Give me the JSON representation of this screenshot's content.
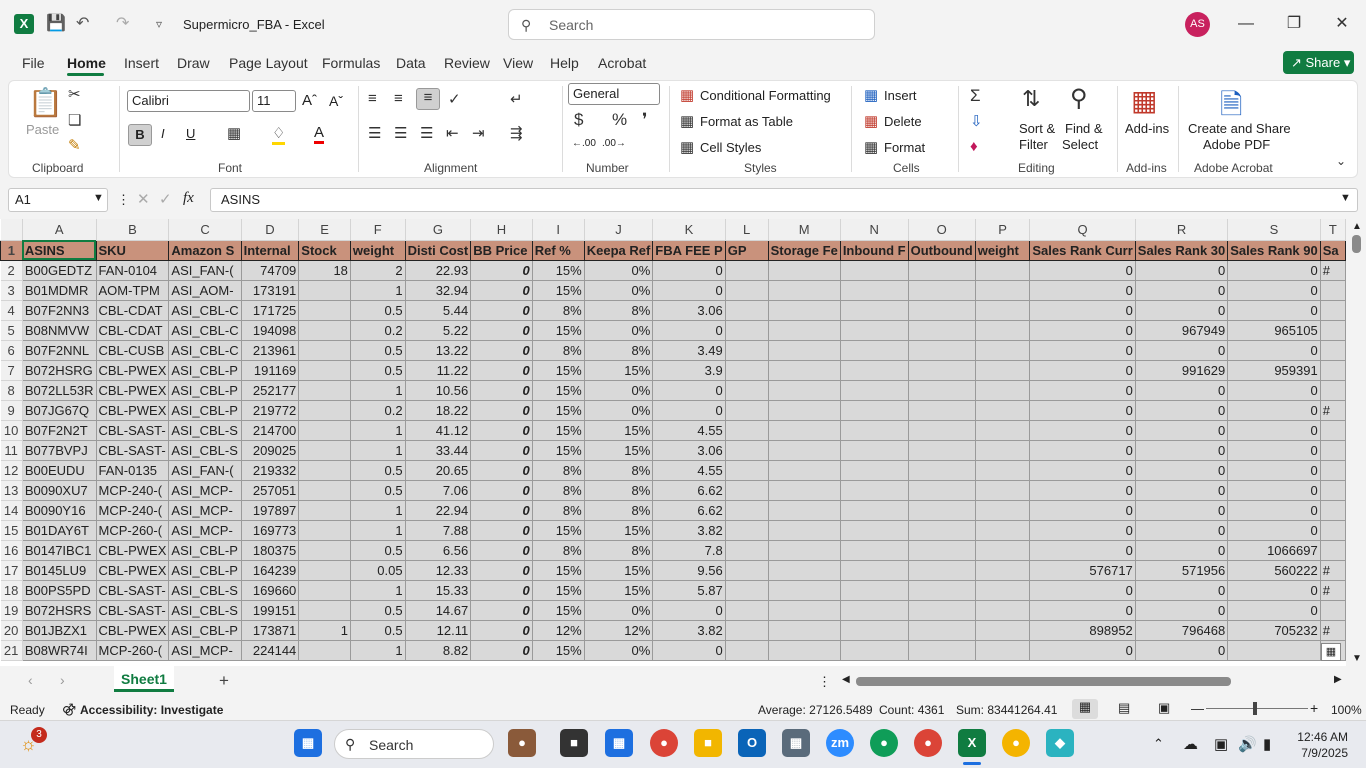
{
  "window": {
    "title": "Supermicro_FBA  -  Excel",
    "search_placeholder": "Search",
    "user_initials": "AS"
  },
  "menu": [
    "File",
    "Home",
    "Insert",
    "Draw",
    "Page Layout",
    "Formulas",
    "Data",
    "Review",
    "View",
    "Help",
    "Acrobat"
  ],
  "share_label": "Share",
  "ribbon": {
    "clipboard": {
      "label": "Clipboard",
      "paste": "Paste"
    },
    "font": {
      "label": "Font",
      "family": "Calibri",
      "size": "11"
    },
    "alignment": {
      "label": "Alignment"
    },
    "number": {
      "label": "Number",
      "format": "General"
    },
    "styles": {
      "label": "Styles",
      "conditional": "Conditional Formatting",
      "format_table": "Format as Table",
      "cell_styles": "Cell Styles"
    },
    "cells": {
      "label": "Cells",
      "insert": "Insert",
      "delete": "Delete",
      "format": "Format"
    },
    "editing": {
      "label": "Editing",
      "sort_filter_1": "Sort &",
      "sort_filter_2": "Filter",
      "find_select_1": "Find &",
      "find_select_2": "Select"
    },
    "addins": {
      "label": "Add-ins",
      "button": "Add-ins"
    },
    "acrobat": {
      "label": "Adobe Acrobat",
      "button_1": "Create and Share",
      "button_2": "Adobe PDF"
    }
  },
  "formula_bar": {
    "name_box": "A1",
    "fx": "fx",
    "content": "ASINS"
  },
  "columns": [
    "A",
    "B",
    "C",
    "D",
    "E",
    "F",
    "G",
    "H",
    "I",
    "J",
    "K",
    "L",
    "M",
    "N",
    "O",
    "P",
    "Q",
    "R",
    "S",
    "T"
  ],
  "headers": [
    "ASINS",
    "SKU",
    "Amazon S",
    "Internal",
    "Stock",
    "weight",
    "Disti Cost",
    "BB Price",
    "Ref %",
    "Keepa Ref",
    "FBA FEE P",
    "GP",
    "Storage Fe",
    "Inbound F",
    "Outbound",
    "weight",
    "Sales Rank Curr",
    "Sales Rank 30",
    "Sales Rank 90",
    "Sa"
  ],
  "rows": [
    [
      "2",
      "B00GEDTZ",
      "FAN-0104",
      "ASI_FAN-(",
      "74709",
      "18",
      "2",
      "22.93",
      "0",
      "15%",
      "0%",
      "0",
      "",
      "",
      "",
      "",
      "",
      "0",
      "0",
      "0",
      "#"
    ],
    [
      "3",
      "B01MDMR",
      "AOM-TPM",
      "ASI_AOM-",
      "173191",
      "",
      "1",
      "32.94",
      "0",
      "15%",
      "0%",
      "0",
      "",
      "",
      "",
      "",
      "",
      "0",
      "0",
      "0",
      ""
    ],
    [
      "4",
      "B07F2NN3",
      "CBL-CDAT",
      "ASI_CBL-C",
      "171725",
      "",
      "0.5",
      "5.44",
      "0",
      "8%",
      "8%",
      "3.06",
      "",
      "",
      "",
      "",
      "",
      "0",
      "0",
      "0",
      ""
    ],
    [
      "5",
      "B08NMVW",
      "CBL-CDAT",
      "ASI_CBL-C",
      "194098",
      "",
      "0.2",
      "5.22",
      "0",
      "15%",
      "0%",
      "0",
      "",
      "",
      "",
      "",
      "",
      "0",
      "967949",
      "965105",
      ""
    ],
    [
      "6",
      "B07F2NNL",
      "CBL-CUSB",
      "ASI_CBL-C",
      "213961",
      "",
      "0.5",
      "13.22",
      "0",
      "8%",
      "8%",
      "3.49",
      "",
      "",
      "",
      "",
      "",
      "0",
      "0",
      "0",
      ""
    ],
    [
      "7",
      "B072HSRG",
      "CBL-PWEX",
      "ASI_CBL-P",
      "191169",
      "",
      "0.5",
      "11.22",
      "0",
      "15%",
      "15%",
      "3.9",
      "",
      "",
      "",
      "",
      "",
      "0",
      "991629",
      "959391",
      ""
    ],
    [
      "8",
      "B072LL53R",
      "CBL-PWEX",
      "ASI_CBL-P",
      "252177",
      "",
      "1",
      "10.56",
      "0",
      "15%",
      "0%",
      "0",
      "",
      "",
      "",
      "",
      "",
      "0",
      "0",
      "0",
      ""
    ],
    [
      "9",
      "B07JG67Q",
      "CBL-PWEX",
      "ASI_CBL-P",
      "219772",
      "",
      "0.2",
      "18.22",
      "0",
      "15%",
      "0%",
      "0",
      "",
      "",
      "",
      "",
      "",
      "0",
      "0",
      "0",
      "#"
    ],
    [
      "10",
      "B07F2N2T",
      "CBL-SAST-",
      "ASI_CBL-S",
      "214700",
      "",
      "1",
      "41.12",
      "0",
      "15%",
      "15%",
      "4.55",
      "",
      "",
      "",
      "",
      "",
      "0",
      "0",
      "0",
      ""
    ],
    [
      "11",
      "B077BVPJ",
      "CBL-SAST-",
      "ASI_CBL-S",
      "209025",
      "",
      "1",
      "33.44",
      "0",
      "15%",
      "15%",
      "3.06",
      "",
      "",
      "",
      "",
      "",
      "0",
      "0",
      "0",
      ""
    ],
    [
      "12",
      "B00EUDU",
      "FAN-0135",
      "ASI_FAN-(",
      "219332",
      "",
      "0.5",
      "20.65",
      "0",
      "8%",
      "8%",
      "4.55",
      "",
      "",
      "",
      "",
      "",
      "0",
      "0",
      "0",
      ""
    ],
    [
      "13",
      "B0090XU7",
      "MCP-240-(",
      "ASI_MCP-",
      "257051",
      "",
      "0.5",
      "7.06",
      "0",
      "8%",
      "8%",
      "6.62",
      "",
      "",
      "",
      "",
      "",
      "0",
      "0",
      "0",
      ""
    ],
    [
      "14",
      "B0090Y16",
      "MCP-240-(",
      "ASI_MCP-",
      "197897",
      "",
      "1",
      "22.94",
      "0",
      "8%",
      "8%",
      "6.62",
      "",
      "",
      "",
      "",
      "",
      "0",
      "0",
      "0",
      ""
    ],
    [
      "15",
      "B01DAY6T",
      "MCP-260-(",
      "ASI_MCP-",
      "169773",
      "",
      "1",
      "7.88",
      "0",
      "15%",
      "15%",
      "3.82",
      "",
      "",
      "",
      "",
      "",
      "0",
      "0",
      "0",
      ""
    ],
    [
      "16",
      "B0147IBC1",
      "CBL-PWEX",
      "ASI_CBL-P",
      "180375",
      "",
      "0.5",
      "6.56",
      "0",
      "8%",
      "8%",
      "7.8",
      "",
      "",
      "",
      "",
      "",
      "0",
      "0",
      "1066697",
      ""
    ],
    [
      "17",
      "B0145LU9",
      "CBL-PWEX",
      "ASI_CBL-P",
      "164239",
      "",
      "0.05",
      "12.33",
      "0",
      "15%",
      "15%",
      "9.56",
      "",
      "",
      "",
      "",
      "",
      "576717",
      "571956",
      "560222",
      "#"
    ],
    [
      "18",
      "B00PS5PD",
      "CBL-SAST-",
      "ASI_CBL-S",
      "169660",
      "",
      "1",
      "15.33",
      "0",
      "15%",
      "15%",
      "5.87",
      "",
      "",
      "",
      "",
      "",
      "0",
      "0",
      "0",
      "#"
    ],
    [
      "19",
      "B072HSRS",
      "CBL-SAST-",
      "ASI_CBL-S",
      "199151",
      "",
      "0.5",
      "14.67",
      "0",
      "15%",
      "0%",
      "0",
      "",
      "",
      "",
      "",
      "",
      "0",
      "0",
      "0",
      ""
    ],
    [
      "20",
      "B01JBZX1",
      "CBL-PWEX",
      "ASI_CBL-P",
      "173871",
      "1",
      "0.5",
      "12.11",
      "0",
      "12%",
      "12%",
      "3.82",
      "",
      "",
      "",
      "",
      "",
      "898952",
      "796468",
      "705232",
      "#"
    ],
    [
      "21",
      "B08WR74I",
      "MCP-260-(",
      "ASI_MCP-",
      "224144",
      "",
      "1",
      "8.82",
      "0",
      "15%",
      "0%",
      "0",
      "",
      "",
      "",
      "",
      "",
      "0",
      "0",
      "",
      ""
    ]
  ],
  "sheet_tab": "Sheet1",
  "status": {
    "ready": "Ready",
    "accessibility": "Accessibility: Investigate",
    "average": "Average: 27126.5489",
    "count": "Count: 4361",
    "sum": "Sum: 83441264.41",
    "zoom": "100%"
  },
  "taskbar": {
    "search": "Search",
    "time": "12:46 AM",
    "date": "7/9/2025",
    "notification_count": "3"
  }
}
